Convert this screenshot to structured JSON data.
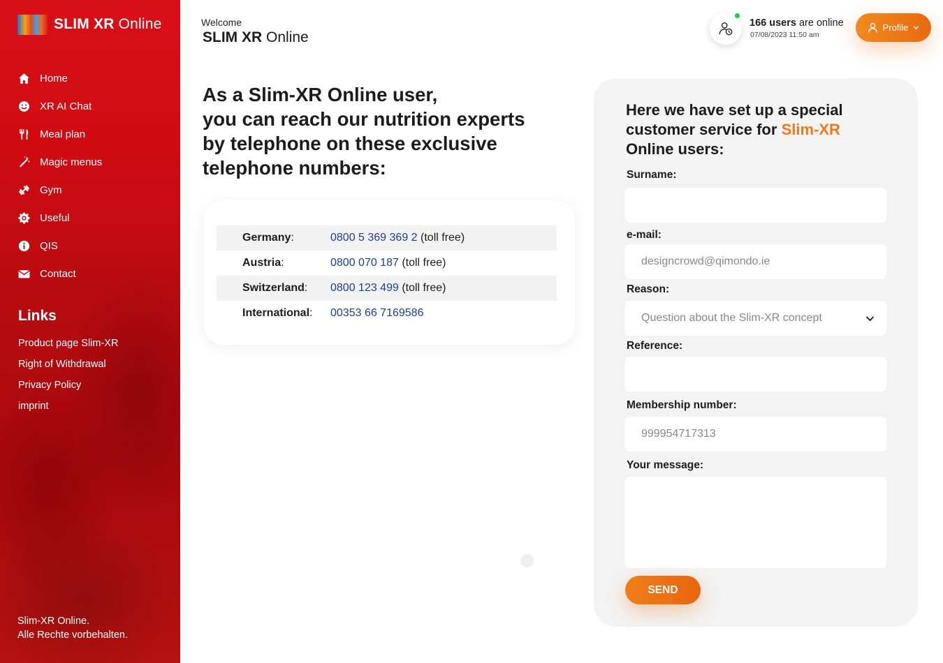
{
  "brand": {
    "bold": "SLIM XR",
    "light": "Online"
  },
  "nav": [
    {
      "label": "Home",
      "icon": "home-icon"
    },
    {
      "label": "XR AI Chat",
      "icon": "smiley-icon"
    },
    {
      "label": "Meal plan",
      "icon": "cutlery-icon"
    },
    {
      "label": "Magic menus",
      "icon": "magic-wand-icon"
    },
    {
      "label": "Gym",
      "icon": "dumbbell-icon"
    },
    {
      "label": "Useful",
      "icon": "gear-icon"
    },
    {
      "label": "QIS",
      "icon": "info-icon"
    },
    {
      "label": "Contact",
      "icon": "envelope-icon"
    }
  ],
  "links": {
    "title": "Links",
    "items": [
      "Product page Slim-XR",
      "Right of Withdrawal",
      "Privacy Policy",
      "imprint"
    ]
  },
  "sidebar_footer": {
    "line1": "Slim-XR Online.",
    "line2": "Alle Rechte vorbehalten."
  },
  "header": {
    "welcome": "Welcome",
    "brand_bold": "SLIM XR",
    "brand_light": "Online",
    "online_count": "166 users",
    "online_suffix": "are online",
    "datetime": "07/08/2023 11:50 am",
    "profile_label": "Profile"
  },
  "main": {
    "heading_lines": [
      "As a Slim-XR Online user,",
      "you can reach our nutrition experts",
      "by telephone on these exclusive",
      "telephone numbers:"
    ],
    "phones": [
      {
        "country": "Germany",
        "number": "0800 5 369 369 2",
        "note": "(toll free)"
      },
      {
        "country": "Austria",
        "number": "0800 070 187",
        "note": "(toll free)"
      },
      {
        "country": "Switzerland",
        "number": "0800 123 499",
        "note": "(toll free)"
      },
      {
        "country": "International",
        "number": "00353 66 7169586",
        "note": ""
      }
    ]
  },
  "form": {
    "title_part1": "Here we have set up a special customer service for",
    "title_highlight": "Slim-XR",
    "title_part2": "Online users:",
    "surname_label": "Surname:",
    "surname_value": "",
    "email_label": "e-mail:",
    "email_value": "designcrowd@qimondo.ie",
    "reason_label": "Reason:",
    "reason_value": "Question about the Slim-XR concept",
    "reference_label": "Reference:",
    "reference_value": "",
    "membership_label": "Membership number:",
    "membership_value": "999954717313",
    "message_label": "Your message:",
    "message_value": "",
    "send_label": "SEND"
  },
  "colors": {
    "sidebar_red": "#d0101a",
    "accent_orange": "#ef7a1a",
    "link_blue": "#1d3f8f",
    "online_green": "#2cc44b"
  }
}
